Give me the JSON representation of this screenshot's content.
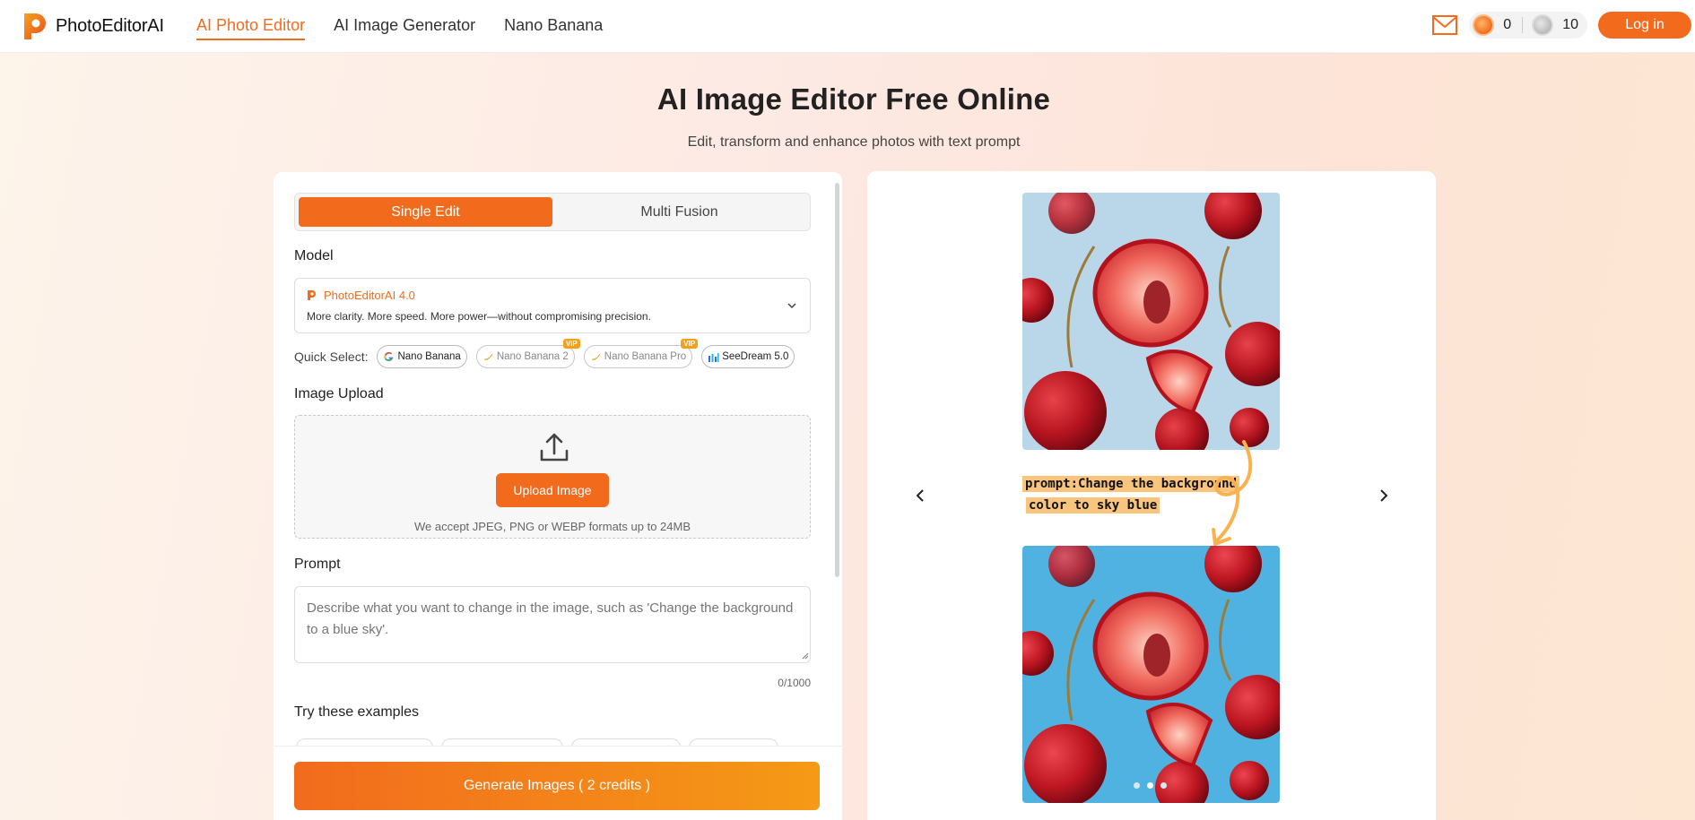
{
  "header": {
    "brand": "PhotoEditorAI",
    "nav": [
      {
        "label": "AI Photo Editor",
        "active": true
      },
      {
        "label": "AI Image Generator",
        "active": false
      },
      {
        "label": "Nano Banana",
        "active": false
      }
    ],
    "credits_paid": "0",
    "credits_free": "10",
    "login_label": "Log in"
  },
  "hero": {
    "title": "AI Image Editor Free Online",
    "subtitle": "Edit, transform and enhance photos with text prompt"
  },
  "editor": {
    "tabs": [
      {
        "label": "Single Edit",
        "selected": true
      },
      {
        "label": "Multi Fusion",
        "selected": false
      }
    ],
    "model_label": "Model",
    "model": {
      "name": "PhotoEditorAI 4.0",
      "description": "More clarity. More speed. More power—without compromising precision."
    },
    "quick_select_label": "Quick Select:",
    "quick_select": [
      {
        "label": "Nano Banana",
        "icon": "google-icon",
        "vip": false,
        "dim": false
      },
      {
        "label": "Nano Banana 2",
        "icon": "banana-icon",
        "vip": true,
        "dim": true
      },
      {
        "label": "Nano Banana Pro",
        "icon": "banana-icon",
        "vip": true,
        "dim": true
      },
      {
        "label": "SeeDream 5.0",
        "icon": "bars-icon",
        "vip": false,
        "dim": false
      }
    ],
    "vip_badge": "VIP",
    "upload_label": "Image Upload",
    "upload_button": "Upload Image",
    "upload_note": "We accept JPEG, PNG or WEBP formats up to 24MB",
    "prompt_label": "Prompt",
    "prompt_placeholder": "Describe what you want to change in the image, such as 'Change the background to a blue sky'.",
    "prompt_counter": "0/1000",
    "examples_label": "Try these examples",
    "generate_button": "Generate Images ( 2 credits )"
  },
  "showcase": {
    "prompt_line1": "prompt:Change the background",
    "prompt_line2": "color to sky blue",
    "slide_count": 3,
    "active_slide": 2,
    "colors": {
      "before_bg": "#b9d7e8",
      "after_bg": "#4fb2e0",
      "accent": "#f26b1d"
    }
  }
}
